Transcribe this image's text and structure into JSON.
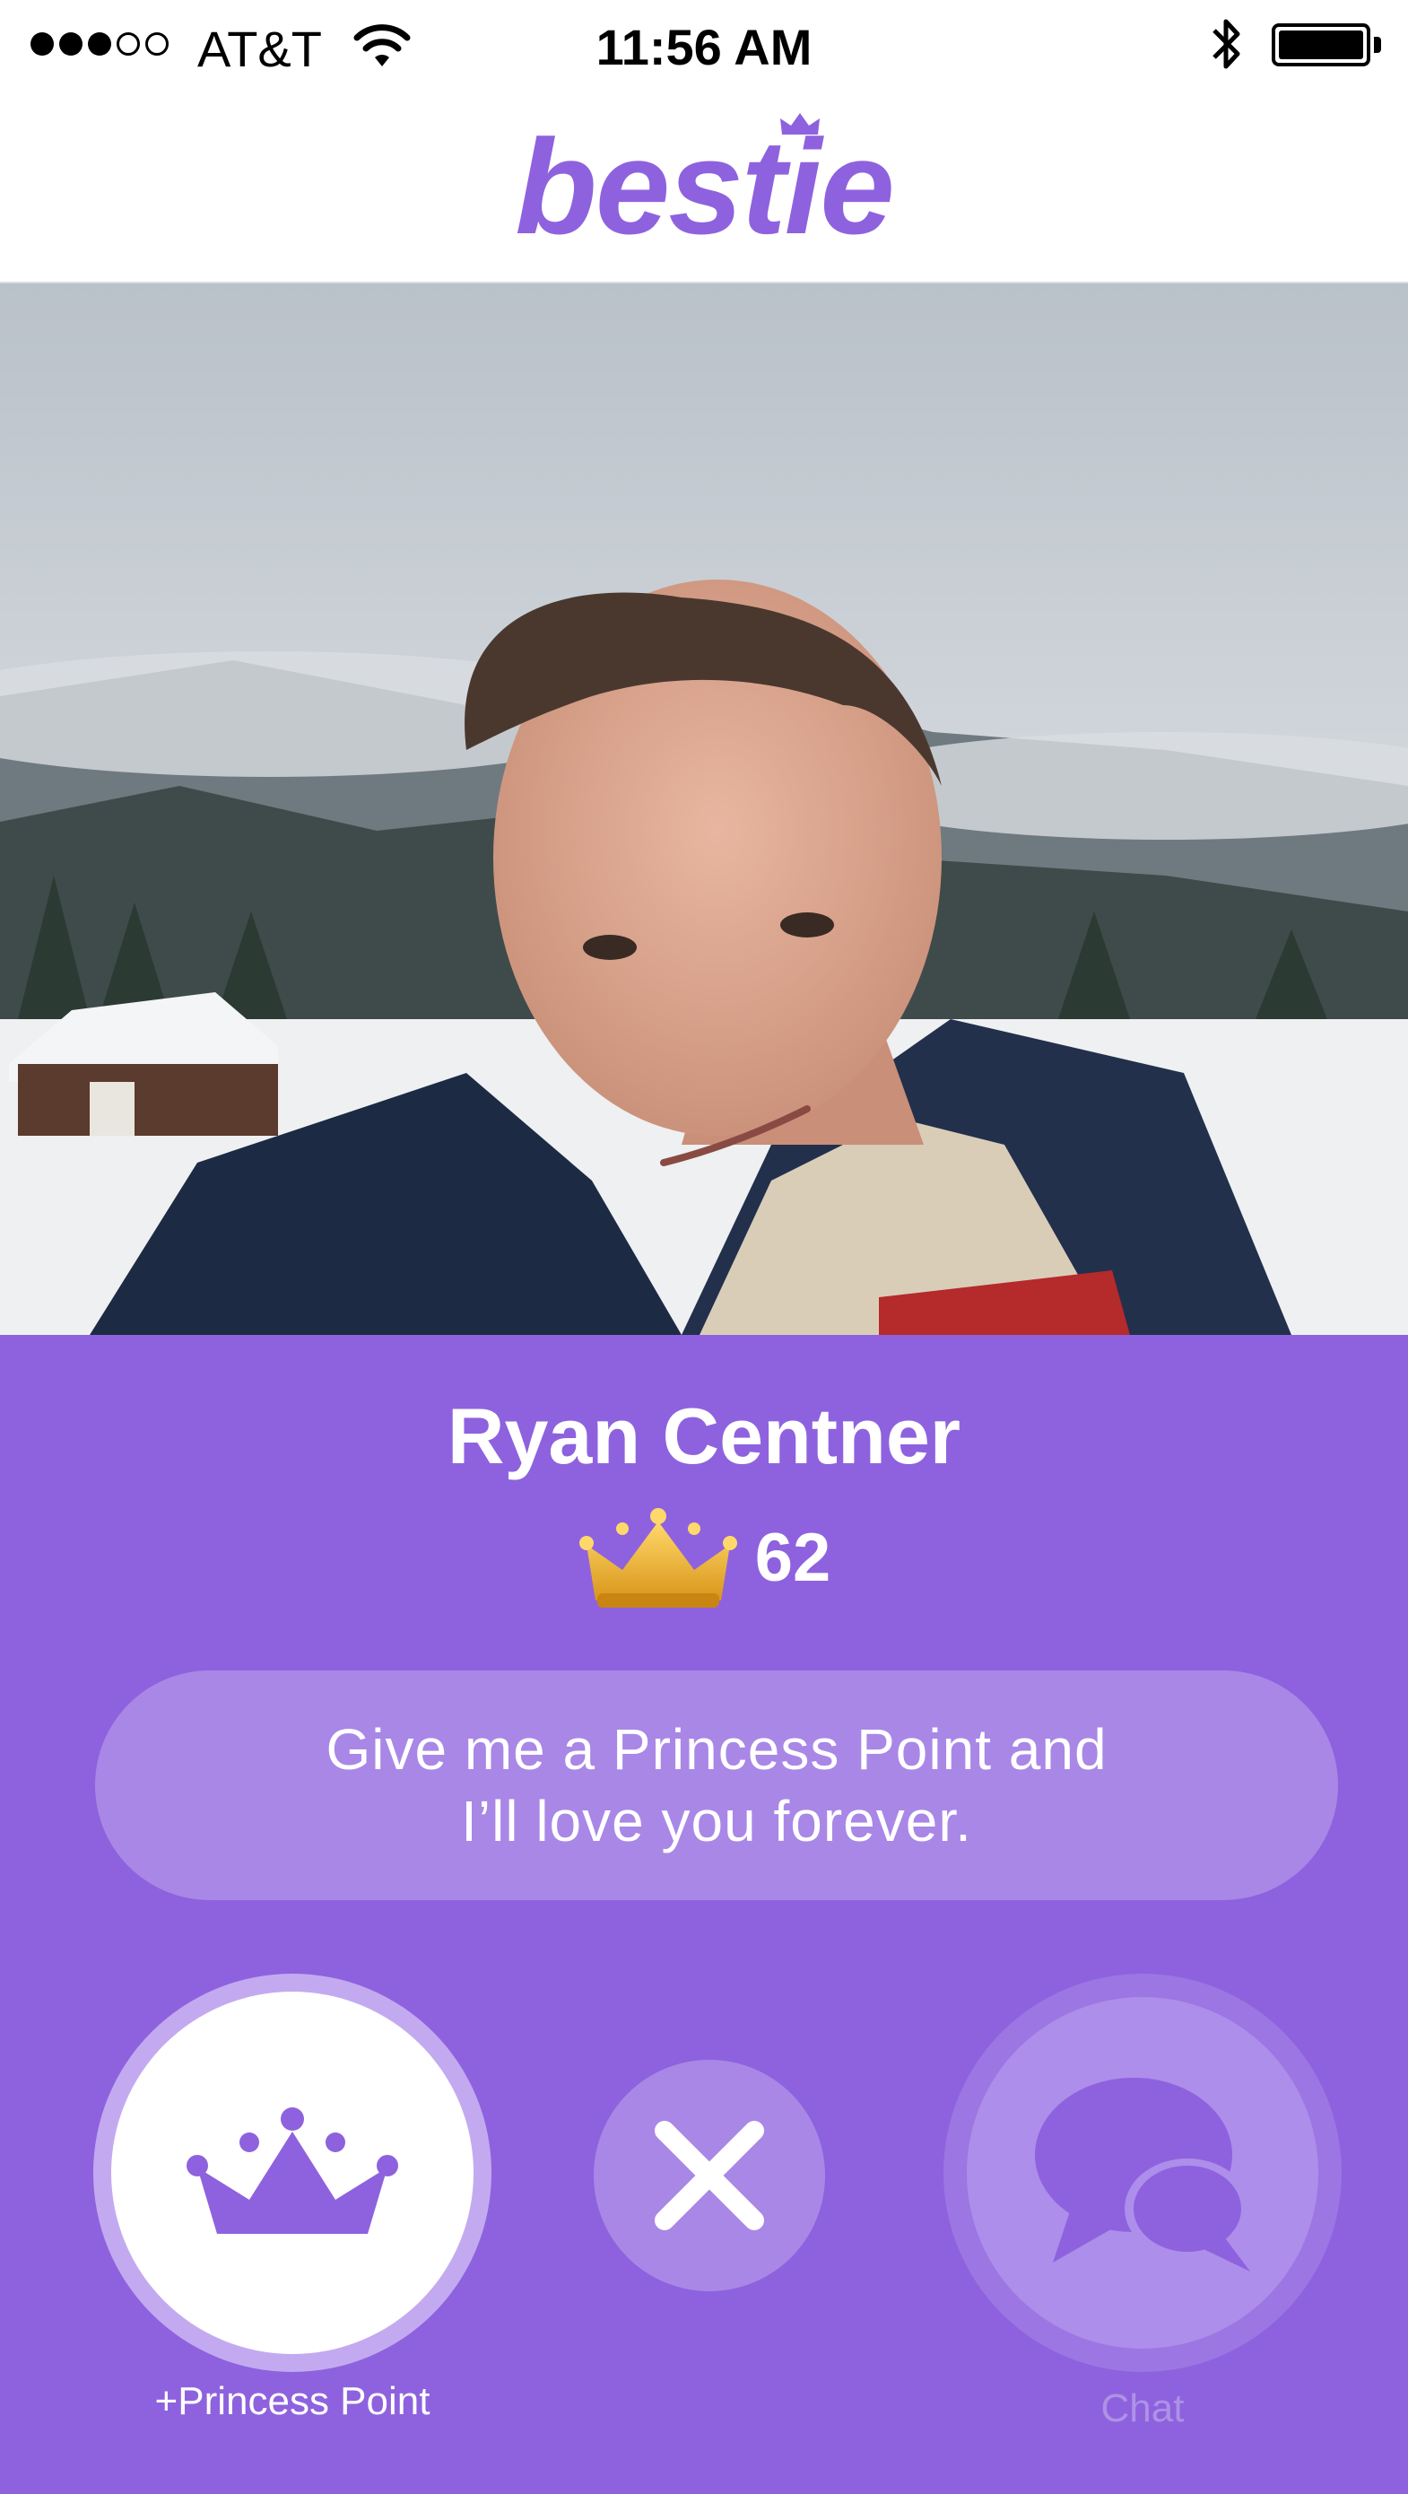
{
  "status_bar": {
    "carrier": "AT&T",
    "time": "11:56 AM",
    "signal_bars_filled": 3,
    "signal_bars_total": 5,
    "battery_level": 1.0
  },
  "header": {
    "logo_text": "bestie",
    "brand_color": "#8e62de"
  },
  "profile": {
    "name": "Ryan Centner",
    "princess_points": "62",
    "bio": {
      "line1": "Give me a Princess Point and",
      "line2": "I’ll love you forever."
    },
    "photo_description_icon": "profile-photo"
  },
  "actions": {
    "princess_point_label": "+Princess Point",
    "chat_label": "Chat",
    "icons": [
      "crown-icon",
      "close-icon",
      "chat-icon"
    ]
  },
  "colors": {
    "panel": "#8e62de",
    "bubble": "#a987e6",
    "crown_gold": "#e0a81c"
  }
}
